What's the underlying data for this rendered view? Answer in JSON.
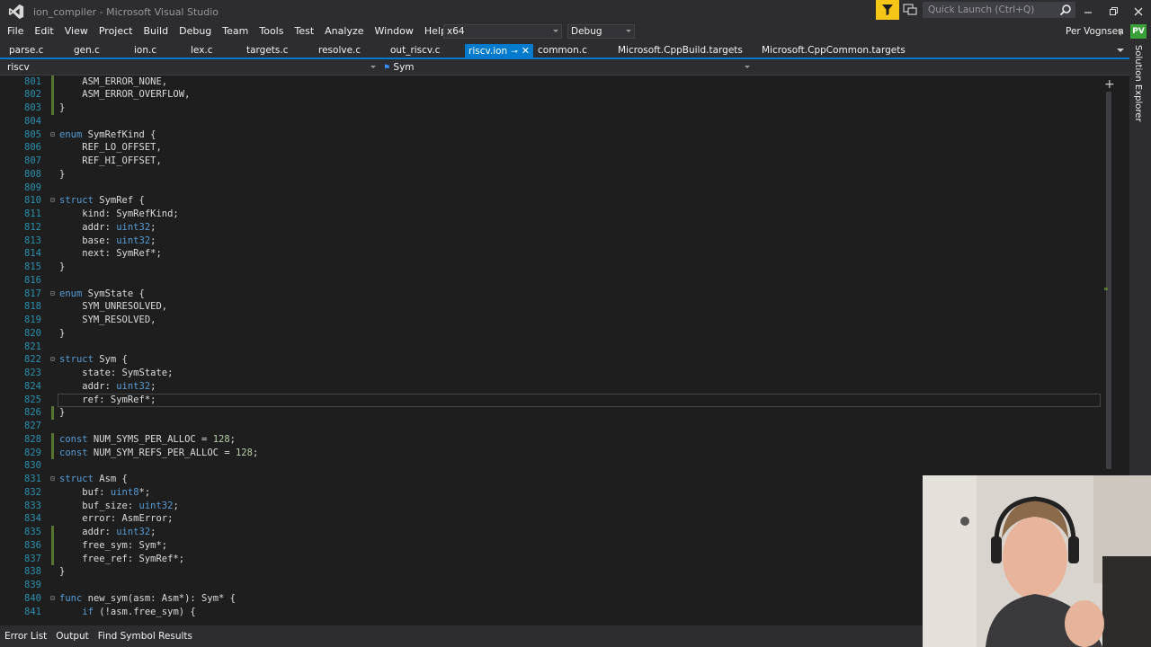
{
  "window": {
    "title": "ion_compiler - Microsoft Visual Studio",
    "quick_launch_placeholder": "Quick Launch (Ctrl+Q)",
    "user_name": "Per Vognsen",
    "user_initials": "PV"
  },
  "menu": [
    "File",
    "Edit",
    "View",
    "Project",
    "Build",
    "Debug",
    "Team",
    "Tools",
    "Test",
    "Analyze",
    "Window",
    "Help"
  ],
  "toolbar": {
    "platform": "x64",
    "configuration": "Debug"
  },
  "tabs": [
    "parse.c",
    "gen.c",
    "ion.c",
    "lex.c",
    "targets.c",
    "resolve.c",
    "out_riscv.c",
    "riscv.ion",
    "common.c",
    "Microsoft.CppBuild.targets",
    "Microsoft.CppCommon.targets"
  ],
  "active_tab": "riscv.ion",
  "navbar": {
    "scope": "riscv",
    "member": "Sym"
  },
  "side_panel": {
    "label": "Solution Explorer"
  },
  "bottom_tabs": [
    "Error List",
    "Output",
    "Find Symbol Results"
  ],
  "code_lines": [
    {
      "n": "801",
      "text": "    ASM_ERROR_NONE,"
    },
    {
      "n": "802",
      "text": "    ASM_ERROR_OVERFLOW,"
    },
    {
      "n": "803",
      "text": "}"
    },
    {
      "n": "804",
      "text": ""
    },
    {
      "n": "805",
      "text": "enum SymRefKind {"
    },
    {
      "n": "806",
      "text": "    REF_LO_OFFSET,"
    },
    {
      "n": "807",
      "text": "    REF_HI_OFFSET,"
    },
    {
      "n": "808",
      "text": "}"
    },
    {
      "n": "809",
      "text": ""
    },
    {
      "n": "810",
      "text": "struct SymRef {"
    },
    {
      "n": "811",
      "text": "    kind: SymRefKind;"
    },
    {
      "n": "812",
      "text": "    addr: uint32;"
    },
    {
      "n": "813",
      "text": "    base: uint32;"
    },
    {
      "n": "814",
      "text": "    next: SymRef*;"
    },
    {
      "n": "815",
      "text": "}"
    },
    {
      "n": "816",
      "text": ""
    },
    {
      "n": "817",
      "text": "enum SymState {"
    },
    {
      "n": "818",
      "text": "    SYM_UNRESOLVED,"
    },
    {
      "n": "819",
      "text": "    SYM_RESOLVED,"
    },
    {
      "n": "820",
      "text": "}"
    },
    {
      "n": "821",
      "text": ""
    },
    {
      "n": "822",
      "text": "struct Sym {"
    },
    {
      "n": "823",
      "text": "    state: SymState;"
    },
    {
      "n": "824",
      "text": "    addr: uint32;"
    },
    {
      "n": "825",
      "text": "    ref: SymRef*;"
    },
    {
      "n": "826",
      "text": "}"
    },
    {
      "n": "827",
      "text": ""
    },
    {
      "n": "828",
      "text": "const NUM_SYMS_PER_ALLOC = 128;"
    },
    {
      "n": "829",
      "text": "const NUM_SYM_REFS_PER_ALLOC = 128;"
    },
    {
      "n": "830",
      "text": ""
    },
    {
      "n": "831",
      "text": "struct Asm {"
    },
    {
      "n": "832",
      "text": "    buf: uint8*;"
    },
    {
      "n": "833",
      "text": "    buf_size: uint32;"
    },
    {
      "n": "834",
      "text": "    error: AsmError;"
    },
    {
      "n": "835",
      "text": "    addr: uint32;"
    },
    {
      "n": "836",
      "text": "    free_sym: Sym*;"
    },
    {
      "n": "837",
      "text": "    free_ref: SymRef*;"
    },
    {
      "n": "838",
      "text": "}"
    },
    {
      "n": "839",
      "text": ""
    },
    {
      "n": "840",
      "text": "func new_sym(asm: Asm*): Sym* {"
    },
    {
      "n": "841",
      "text": "    if (!asm.free_sym) {"
    }
  ],
  "current_line": "825",
  "colors": {
    "accent": "#007acc",
    "editor_bg": "#1e1e1e",
    "chrome_bg": "#2d2d30",
    "keyword": "#569cd6",
    "type": "#4ec9b0",
    "number": "#b5cea8",
    "line_number": "#2b91af",
    "change_marker": "#577430",
    "filter_button": "#f5c518"
  },
  "icons": [
    "visual-studio-logo-icon",
    "filter-icon",
    "feedback-icon",
    "search-icon",
    "minimize-icon",
    "maximize-icon",
    "close-icon",
    "pin-icon",
    "tab-close-icon",
    "add-icon"
  ]
}
